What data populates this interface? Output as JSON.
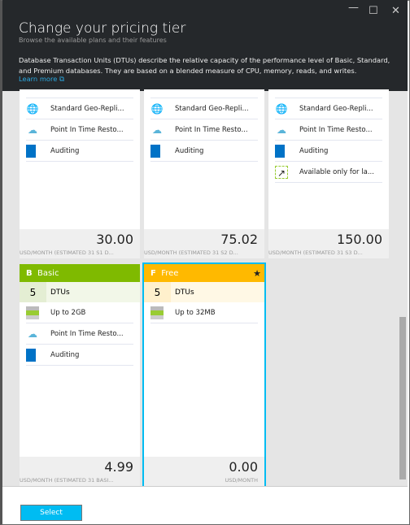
{
  "header": {
    "title": "Change your pricing tier",
    "subtitle": "Browse the available plans and their features",
    "description": "Database Transaction Units (DTUs) describe the relative capacity of the performance level of Basic, Standard, and Premium databases. They are based on a blended measure of CPU, memory, reads, and writes.",
    "learn_more": "Learn more"
  },
  "window": {
    "minimize": "—",
    "maximize": "☐",
    "close": "✕"
  },
  "top_cards": [
    {
      "features": [
        "Standard Geo-Repli...",
        "Point In Time Resto...",
        "Auditing"
      ],
      "price": "30.00",
      "unit": "USD/MONTH (ESTIMATED 31 S1 D..."
    },
    {
      "features": [
        "Standard Geo-Repli...",
        "Point In Time Resto...",
        "Auditing"
      ],
      "price": "75.02",
      "unit": "USD/MONTH (ESTIMATED 31 S2 D..."
    },
    {
      "features": [
        "Standard Geo-Repli...",
        "Point In Time Resto...",
        "Auditing",
        "Available only for la..."
      ],
      "price": "150.00",
      "unit": "USD/MONTH (ESTIMATED 31 S3 D..."
    }
  ],
  "basic": {
    "letter": "B",
    "name": "Basic",
    "color": "#7fba00",
    "dtu": "5",
    "dtu_label": "DTUs",
    "features": [
      "Up to 2GB",
      "Point In Time Resto...",
      "Auditing"
    ],
    "price": "4.99",
    "unit": "USD/MONTH (ESTIMATED 31 BASI..."
  },
  "free": {
    "letter": "F",
    "name": "Free",
    "color": "#ffb900",
    "star": "★",
    "dtu": "5",
    "dtu_label": "DTUs",
    "features": [
      "Up to 32MB"
    ],
    "price": "0.00",
    "unit": "USD/MONTH"
  },
  "footer": {
    "select": "Select"
  }
}
